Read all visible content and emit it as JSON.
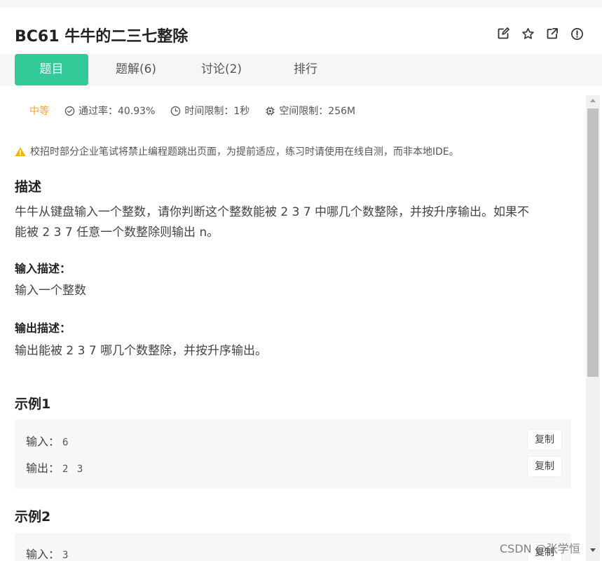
{
  "problem": {
    "title": "BC61  牛牛的二三七整除"
  },
  "title_actions": {
    "edit_icon": "edit-icon",
    "star_icon": "star-icon",
    "share_icon": "external-link-icon",
    "report_icon": "alert-circle-icon"
  },
  "tabs": [
    {
      "label": "题目",
      "active": true
    },
    {
      "label": "题解(6)",
      "active": false
    },
    {
      "label": "讨论(2)",
      "active": false
    },
    {
      "label": "排行",
      "active": false
    }
  ],
  "meta": {
    "difficulty": "中等",
    "pass_rate": "通过率：40.93%",
    "time_limit": "时间限制：1秒",
    "space_limit": "空间限制：256M"
  },
  "notice": "校招时部分企业笔试将禁止编程题跳出页面，为提前适应，练习时请使用在线自测，而非本地IDE。",
  "description": {
    "heading": "描述",
    "line1": "牛牛从键盘输入一个整数，请你判断这个整数能被 2 3 7 中哪几个数整除，并按升序输出。如果不",
    "line2": "能被 2 3 7 任意一个数整除则输出 n。"
  },
  "input_desc": {
    "heading": "输入描述：",
    "text": "输入一个整数"
  },
  "output_desc": {
    "heading": "输出描述：",
    "text": "输出能被 2 3 7 哪几个数整除，并按升序输出。"
  },
  "examples": [
    {
      "heading": "示例1",
      "input_label": "输入：",
      "input_value": "6",
      "output_label": "输出：",
      "output_value": "2 3",
      "copy_label": "复制"
    },
    {
      "heading": "示例2",
      "input_label": "输入：",
      "input_value": "3",
      "copy_label": "复制"
    }
  ],
  "watermark": "CSDN @张学恒",
  "colors": {
    "accent": "#32ca99",
    "difficulty": "#f5a623",
    "warning": "#f5b400"
  }
}
